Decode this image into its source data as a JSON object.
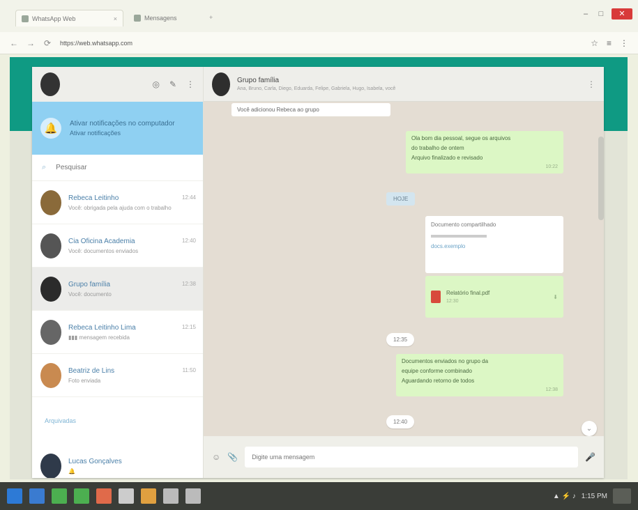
{
  "browser": {
    "tabs": [
      {
        "label": "WhatsApp Web",
        "close": "×"
      },
      {
        "label": "Mensagens"
      }
    ],
    "new_tab": "+",
    "window_buttons": {
      "minimize": "–",
      "maximize": "□",
      "close": "✕"
    },
    "nav": {
      "back": "←",
      "forward": "→",
      "reload": "⟳"
    },
    "url": "https://web.whatsapp.com",
    "toolbar_icons": [
      "☆",
      "≡",
      "⋮"
    ]
  },
  "sidebar": {
    "header_icons": [
      "◎",
      "✎",
      "⋮"
    ],
    "notification": {
      "title": "Ativar notificações no computador",
      "subtitle": "Ativar notificações"
    },
    "search": {
      "icon": "⌕",
      "placeholder": "Pesquisar"
    },
    "chats": [
      {
        "name": "Rebeca Leitinho",
        "time": "12:44",
        "preview": "Você: obrigada pela ajuda com o trabalho",
        "avatar_color": "#8a6a3a"
      },
      {
        "name": "Cia Oficina Academia",
        "time": "12:40",
        "preview": "Você: documentos enviados",
        "avatar_color": "#555555"
      },
      {
        "name": "Grupo família",
        "time": "12:38",
        "preview": "Você: documento",
        "avatar_color": "#2b2b2b"
      },
      {
        "name": "Rebeca Leitinho Lima",
        "time": "12:15",
        "preview": "▮▮▮ mensagem recebida",
        "avatar_color": "#666666"
      },
      {
        "name": "Beatriz de Lins",
        "time": "11:50",
        "preview": "Foto enviada",
        "avatar_color": "#c98a50"
      }
    ],
    "archived": "Arquivadas",
    "bottom_chat": {
      "name": "Lucas Gonçalves",
      "preview": "🔔",
      "avatar_color": "#2f3a4a"
    }
  },
  "main": {
    "group_name": "Grupo família",
    "members": "Ana, Bruno, Carla, Diego, Eduarda, Felipe, Gabriela, Hugo, Isabela, você",
    "menu_icon": "⋮",
    "messages": {
      "top_in": "Você adicionou Rebeca ao grupo",
      "out_1": {
        "lines": [
          "Ola bom dia pessoal, segue os arquivos",
          "do trabalho de ontem",
          "Arquivo finalizado e revisado"
        ],
        "time": "10:22"
      },
      "day_1": "HOJE",
      "link_card": {
        "title": "Documento compartilhado",
        "link": "docs.exemplo"
      },
      "file": {
        "name": "Relatório final.pdf",
        "time": "12:30",
        "download": "⬇"
      },
      "time_chip_1": "12:35",
      "out_2": {
        "lines": [
          "Documentos enviados no grupo da",
          "equipe conforme combinado",
          "Aguardando retorno de todos"
        ],
        "time": "12:38"
      },
      "time_chip_2": "12:40"
    },
    "scroll_down": "⌄",
    "composer": {
      "emoji": "☺",
      "attach": "📎",
      "placeholder": "Digite uma mensagem",
      "mic": "🎤"
    }
  },
  "taskbar": {
    "items": [
      "#2d7ad6",
      "#3a7bd0",
      "#4caf50",
      "#4caf50",
      "#e06a4a",
      "#cccccc",
      "#e0a040",
      "#bbbbbb",
      "#bbbbbb"
    ],
    "clock": "1:15 PM",
    "tray_icons": "▲ ⚡ ♪"
  }
}
